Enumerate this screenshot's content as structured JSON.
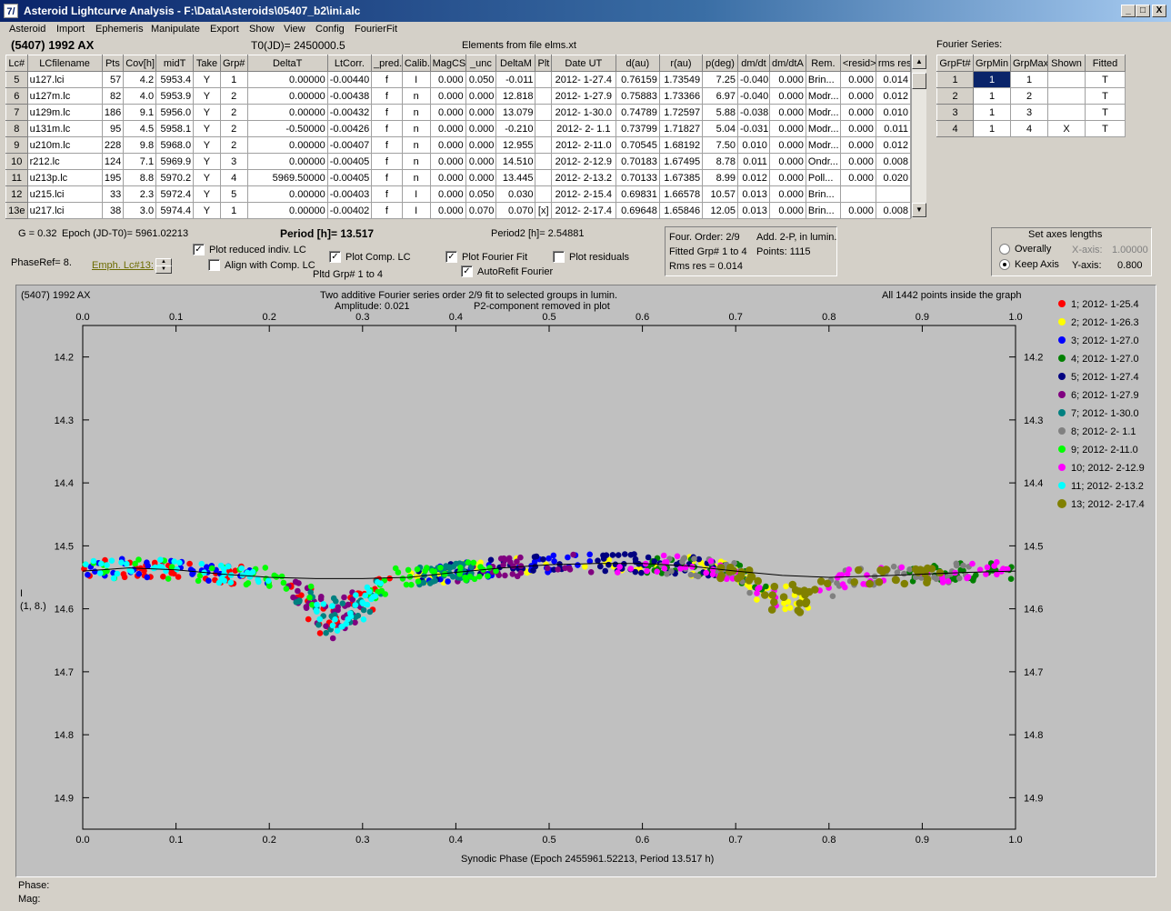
{
  "window": {
    "title": "Asteroid Lightcurve Analysis - F:\\Data\\Asteroids\\05407_b2\\ini.alc",
    "minimize": "_",
    "maximize": "□",
    "close": "X"
  },
  "menu": [
    "Asteroid",
    "Import",
    "Ephemeris",
    "Manipulate",
    "Export",
    "Show",
    "View",
    "Config",
    "FourierFit"
  ],
  "header": {
    "asteroid": "(5407) 1992 AX",
    "t0": "T0(JD)= 2450000.5",
    "elements": "Elements from file elms.xt",
    "fourier_label": "Fourier Series:"
  },
  "lc_table": {
    "columns": [
      "Lc#",
      "LCfilename",
      "Pts",
      "Cov[h]",
      "midT",
      "Take",
      "Grp#",
      "DeltaT",
      "LtCorr.",
      "_pred.",
      "Calib.",
      "MagCS",
      "_unc",
      "DeltaM",
      "Plt",
      "Date UT",
      "d(au)",
      "r(au)",
      "p(deg)",
      "dm/dt",
      "dm/dtA",
      "Rem.",
      "<resid>",
      "rms res"
    ],
    "rows": [
      [
        "5",
        "u127.lci",
        "57",
        "4.2",
        "5953.4",
        "Y",
        "1",
        "0.00000",
        "-0.00440",
        "f",
        "I",
        "0.000",
        "0.050",
        "-0.011",
        "",
        "2012- 1-27.4",
        "0.76159",
        "1.73549",
        "7.25",
        "-0.040",
        "0.000",
        "Brin...",
        "0.000",
        "0.014"
      ],
      [
        "6",
        "u127m.lc",
        "82",
        "4.0",
        "5953.9",
        "Y",
        "2",
        "0.00000",
        "-0.00438",
        "f",
        "n",
        "0.000",
        "0.000",
        "12.818",
        "",
        "2012- 1-27.9",
        "0.75883",
        "1.73366",
        "6.97",
        "-0.040",
        "0.000",
        "Modr...",
        "0.000",
        "0.012"
      ],
      [
        "7",
        "u129m.lc",
        "186",
        "9.1",
        "5956.0",
        "Y",
        "2",
        "0.00000",
        "-0.00432",
        "f",
        "n",
        "0.000",
        "0.000",
        "13.079",
        "",
        "2012- 1-30.0",
        "0.74789",
        "1.72597",
        "5.88",
        "-0.038",
        "0.000",
        "Modr...",
        "0.000",
        "0.010"
      ],
      [
        "8",
        "u131m.lc",
        "95",
        "4.5",
        "5958.1",
        "Y",
        "2",
        "-0.50000",
        "-0.00426",
        "f",
        "n",
        "0.000",
        "0.000",
        "-0.210",
        "",
        "2012- 2- 1.1",
        "0.73799",
        "1.71827",
        "5.04",
        "-0.031",
        "0.000",
        "Modr...",
        "0.000",
        "0.011"
      ],
      [
        "9",
        "u210m.lc",
        "228",
        "9.8",
        "5968.0",
        "Y",
        "2",
        "0.00000",
        "-0.00407",
        "f",
        "n",
        "0.000",
        "0.000",
        "12.955",
        "",
        "2012- 2-11.0",
        "0.70545",
        "1.68192",
        "7.50",
        "0.010",
        "0.000",
        "Modr...",
        "0.000",
        "0.012"
      ],
      [
        "10",
        "r212.lc",
        "124",
        "7.1",
        "5969.9",
        "Y",
        "3",
        "0.00000",
        "-0.00405",
        "f",
        "n",
        "0.000",
        "0.000",
        "14.510",
        "",
        "2012- 2-12.9",
        "0.70183",
        "1.67495",
        "8.78",
        "0.011",
        "0.000",
        "Ondr...",
        "0.000",
        "0.008"
      ],
      [
        "11",
        "u213p.lc",
        "195",
        "8.8",
        "5970.2",
        "Y",
        "4",
        "5969.50000",
        "-0.00405",
        "f",
        "n",
        "0.000",
        "0.000",
        "13.445",
        "",
        "2012- 2-13.2",
        "0.70133",
        "1.67385",
        "8.99",
        "0.012",
        "0.000",
        "Poll...",
        "0.000",
        "0.020"
      ],
      [
        "12",
        "u215.lci",
        "33",
        "2.3",
        "5972.4",
        "Y",
        "5",
        "0.00000",
        "-0.00403",
        "f",
        "I",
        "0.000",
        "0.050",
        "0.030",
        "",
        "2012- 2-15.4",
        "0.69831",
        "1.66578",
        "10.57",
        "0.013",
        "0.000",
        "Brin...",
        "",
        ""
      ],
      [
        "13e",
        "u217.lci",
        "38",
        "3.0",
        "5974.4",
        "Y",
        "1",
        "0.00000",
        "-0.00402",
        "f",
        "I",
        "0.000",
        "0.070",
        "0.070",
        "[x]",
        "2012- 2-17.4",
        "0.69648",
        "1.65846",
        "12.05",
        "0.013",
        "0.000",
        "Brin...",
        "0.000",
        "0.008"
      ]
    ]
  },
  "fourier_table": {
    "columns": [
      "GrpFt#",
      "GrpMin",
      "GrpMax",
      "Shown",
      "Fitted"
    ],
    "rows": [
      [
        "1",
        "1",
        "1",
        "",
        "T"
      ],
      [
        "2",
        "1",
        "2",
        "",
        "T"
      ],
      [
        "3",
        "1",
        "3",
        "",
        "T"
      ],
      [
        "4",
        "1",
        "4",
        "X",
        "T"
      ]
    ]
  },
  "info": {
    "g": "G = 0.32",
    "epoch": "Epoch (JD-T0)= 5961.02213",
    "period": "Period [h]= 13.517",
    "period2": "Period2 [h]= 2.54881",
    "phaseref": "PhaseRef= 8.",
    "emph_lc": "Emph. Lc#13:",
    "pltd_grp": "Pltd Grp#  1   to   4"
  },
  "controls": {
    "plot_reduced": "Plot reduced indiv. LC",
    "align_comp": "Align with Comp. LC",
    "plot_comp": "Plot Comp. LC",
    "plot_fourier": "Plot Fourier Fit",
    "autorefit": "AutoRefit Fourier",
    "plot_residuals": "Plot residuals"
  },
  "fit_info": {
    "order": "Four. Order:  2/9",
    "add": "Add. 2-P, in lumin.",
    "fitted": "Fitted Grp# 1 to 4",
    "points": "Points: 1115",
    "rms": "Rms res      = 0.014"
  },
  "axes_panel": {
    "title": "Set axes lengths",
    "overally": "Overally",
    "keep_axis": "Keep Axis",
    "xaxis_label": "X-axis:",
    "xaxis_value": "1.00000",
    "yaxis_label": "Y-axis:",
    "yaxis_value": "0.800"
  },
  "plot_text": {
    "object": "(5407) 1992 AX",
    "desc1": "Two additive Fourier series order 2/9 fit to selected groups in lumin.",
    "desc2a": "Amplitude: 0.021",
    "desc2b": "P2-component removed in plot",
    "inside": "All 1442 points inside the graph",
    "ylabel1": "I",
    "ylabel2": "(1, 8.)",
    "xlabel": "Synodic Phase (Epoch 2455961.52213, Period 13.517 h)"
  },
  "footer": {
    "phase": "Phase:",
    "mag": "Mag:"
  },
  "chart_data": {
    "type": "scatter",
    "xlim": [
      0.0,
      1.0
    ],
    "ylim": [
      14.95,
      14.15
    ],
    "x_ticks": [
      0.0,
      0.1,
      0.2,
      0.3,
      0.4,
      0.5,
      0.6,
      0.7,
      0.8,
      0.9,
      1.0
    ],
    "y_ticks": [
      14.2,
      14.3,
      14.4,
      14.5,
      14.6,
      14.7,
      14.8,
      14.9
    ],
    "x_tick_labels": [
      "0.0",
      "0.1",
      "0.2",
      "0.3",
      "0.4",
      "0.5",
      "0.6",
      "0.7",
      "0.8",
      "0.9",
      "1.0"
    ],
    "y_tick_labels": [
      "14.2",
      "14.3",
      "14.4",
      "14.5",
      "14.6",
      "14.7",
      "14.8",
      "14.9"
    ],
    "grid": false,
    "legend_placement": "right",
    "series": [
      {
        "name": "1; 2012- 1-25.4",
        "color": "#ff0000"
      },
      {
        "name": "2; 2012- 1-26.3",
        "color": "#ffff00"
      },
      {
        "name": "3; 2012- 1-27.0",
        "color": "#0000ff"
      },
      {
        "name": "4; 2012- 1-27.0",
        "color": "#008000"
      },
      {
        "name": "5; 2012- 1-27.4",
        "color": "#000080"
      },
      {
        "name": "6; 2012- 1-27.9",
        "color": "#800080"
      },
      {
        "name": "7; 2012- 1-30.0",
        "color": "#008080"
      },
      {
        "name": "8; 2012- 2- 1.1",
        "color": "#808080"
      },
      {
        "name": "9; 2012- 2-11.0",
        "color": "#00ff00"
      },
      {
        "name": "10; 2012- 2-12.9",
        "color": "#ff00ff"
      },
      {
        "name": "11; 2012- 2-13.2",
        "color": "#00ffff"
      },
      {
        "name": "13; 2012- 2-17.4",
        "color": "#808000"
      }
    ],
    "fit_curve": {
      "x": [
        0.0,
        0.05,
        0.1,
        0.15,
        0.2,
        0.25,
        0.3,
        0.35,
        0.4,
        0.45,
        0.5,
        0.55,
        0.6,
        0.65,
        0.7,
        0.75,
        0.8,
        0.85,
        0.9,
        0.95,
        1.0
      ],
      "y": [
        14.54,
        14.535,
        14.538,
        14.545,
        14.55,
        14.552,
        14.552,
        14.55,
        14.542,
        14.535,
        14.53,
        14.528,
        14.528,
        14.532,
        14.54,
        14.547,
        14.55,
        14.548,
        14.545,
        14.542,
        14.54
      ]
    }
  }
}
